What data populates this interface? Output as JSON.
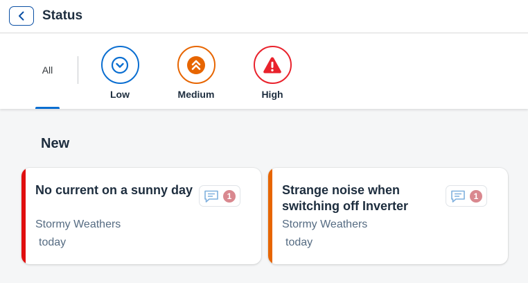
{
  "header": {
    "title": "Status",
    "back_icon": "chevron-left-icon"
  },
  "filter": {
    "all_label": "All",
    "tabs": [
      {
        "label": "Low",
        "icon": "chevron-down-circle-icon",
        "color": "#0a6ed1"
      },
      {
        "label": "Medium",
        "icon": "double-chevron-up-icon",
        "color": "#e76500"
      },
      {
        "label": "High",
        "icon": "warning-triangle-icon",
        "color": "#e9222c"
      }
    ]
  },
  "section": {
    "title": "New"
  },
  "cards": [
    {
      "title": "No current on a sunny day",
      "subtitle": "Stormy Weathers",
      "date": "today",
      "comments": "1",
      "priority_color": "#e00f0f",
      "icon": "comment-icon"
    },
    {
      "title": "Strange noise when switching off Inverter",
      "subtitle": "Stormy Weathers",
      "date": "today",
      "comments": "1",
      "priority_color": "#e76500",
      "icon": "comment-icon"
    }
  ]
}
